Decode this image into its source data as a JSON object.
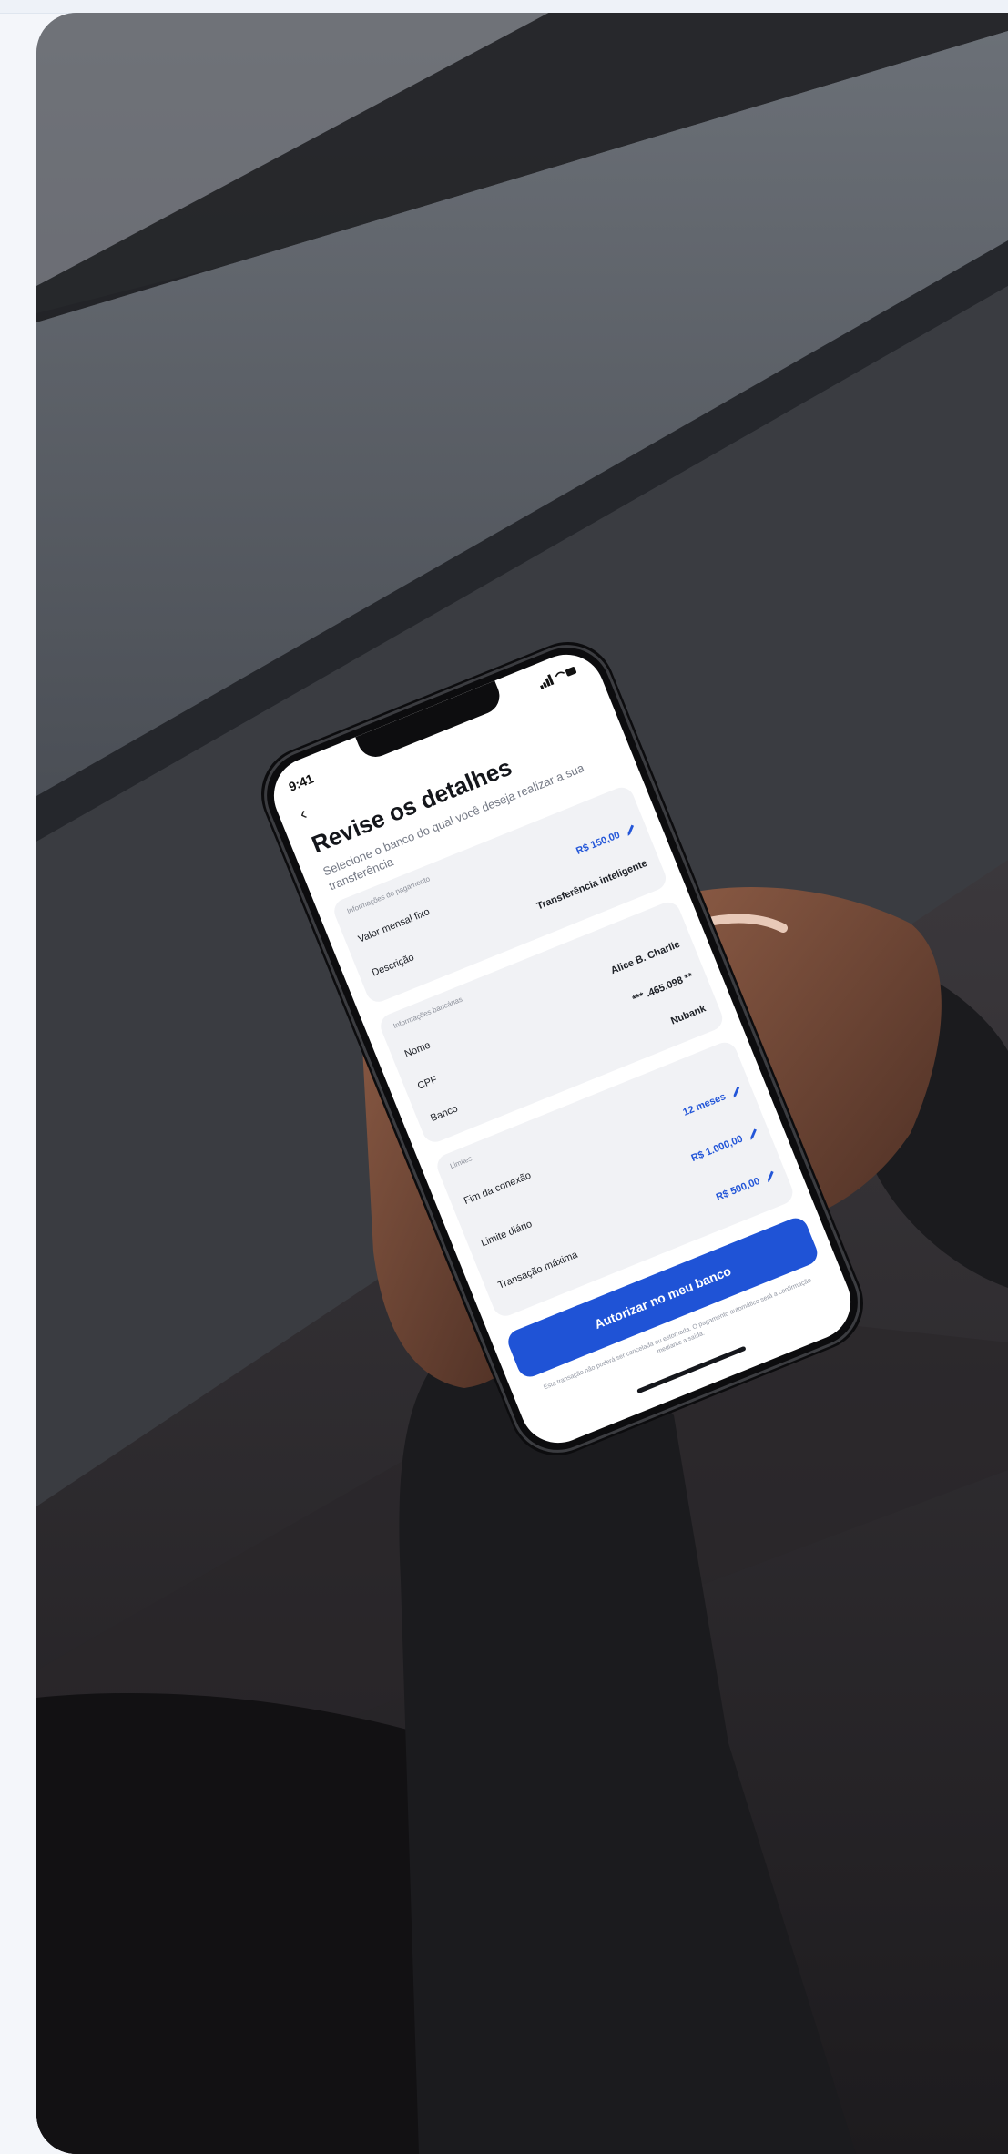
{
  "phone": {
    "status_time": "9:41",
    "back_icon": "chevron-left-icon",
    "title": "Revise os detalhes",
    "subtitle": "Selecione o banco do qual você deseja realizar a sua transferência",
    "payment_info": {
      "label": "Informações do pagamento",
      "rows": [
        {
          "label": "Valor mensal fixo",
          "value": "R$ 150,00",
          "editable": true
        },
        {
          "label": "Descrição",
          "value": "Transferência inteligente",
          "editable": false
        }
      ]
    },
    "bank_info": {
      "label": "Informações bancárias",
      "rows": [
        {
          "label": "Nome",
          "value": "Alice B. Charlie"
        },
        {
          "label": "CPF",
          "value": "*** .465.098 **"
        },
        {
          "label": "Banco",
          "value": "Nubank"
        }
      ]
    },
    "limits": {
      "label": "Limites",
      "rows": [
        {
          "label": "Fim da conexão",
          "value": "12 meses",
          "editable": true
        },
        {
          "label": "Limite diário",
          "value": "R$ 1.000,00",
          "editable": true
        },
        {
          "label": "Transação máxima",
          "value": "R$ 500,00",
          "editable": true
        }
      ]
    },
    "cta_label": "Autorizar no meu banco",
    "footnote": "Esta transação não poderá ser cancelada ou estornada. O pagamento automático será a confirmação mediante a saída.",
    "accent_color": "#1f53d6"
  }
}
